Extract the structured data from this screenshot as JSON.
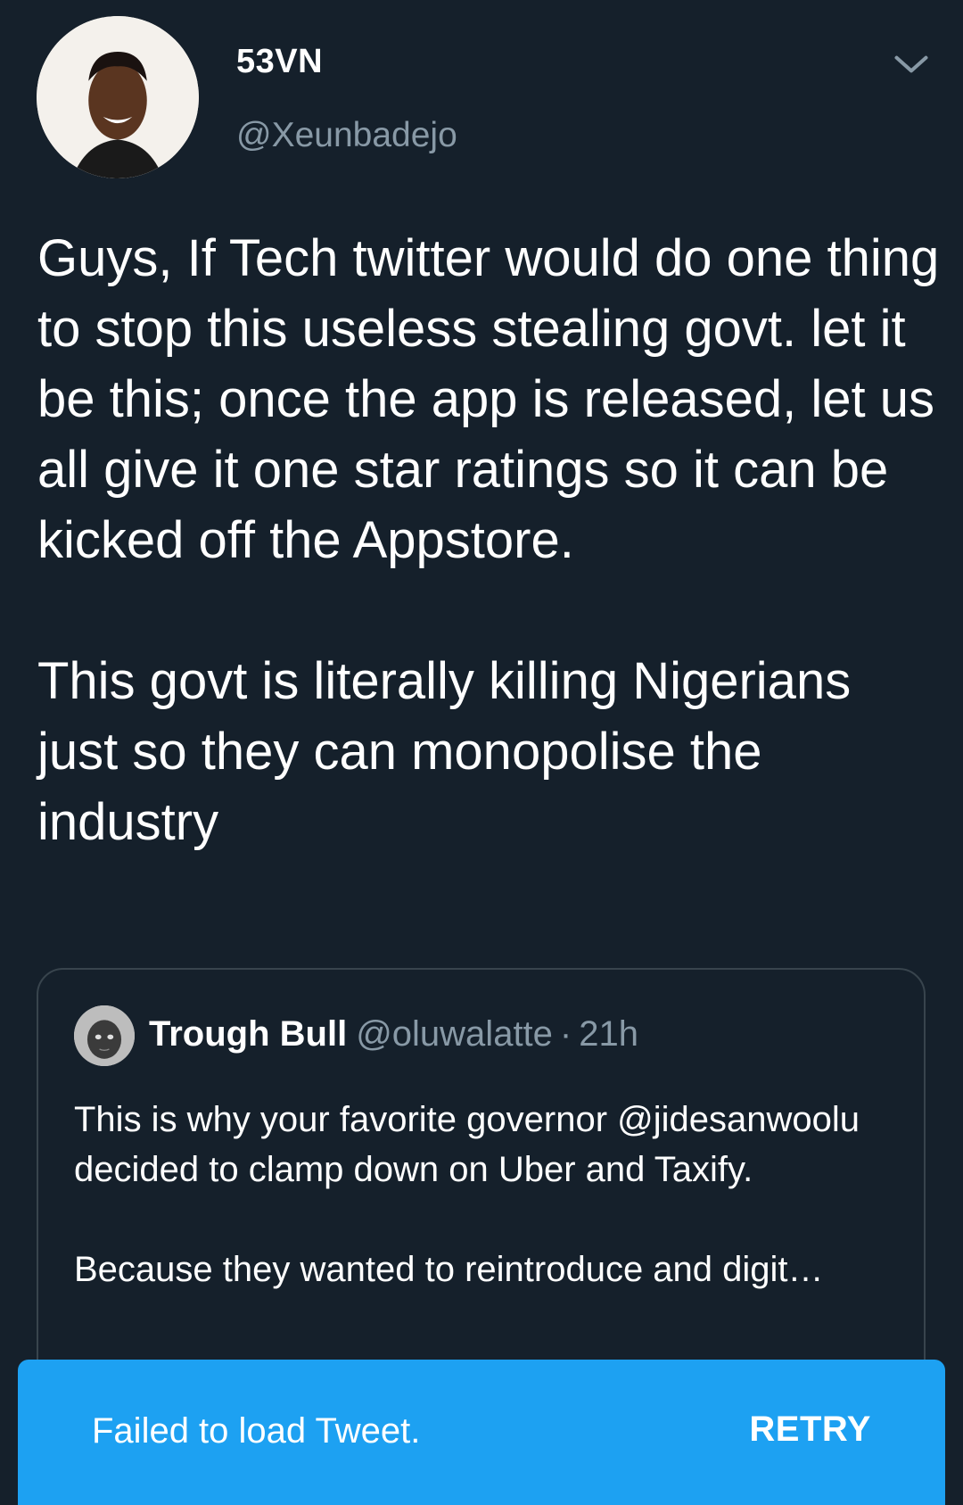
{
  "tweet": {
    "author": {
      "display_name": "53VN",
      "handle": "@Xeunbadejo"
    },
    "text": "Guys, If Tech twitter would do one thing to stop this useless stealing govt. let it be this; once the app is released, let us all give it one star ratings so it can be kicked off the Appstore.\n\nThis govt is literally killing Nigerians just so they can monopolise the industry",
    "menu_icon": "chevron-down-icon"
  },
  "quoted_tweet": {
    "display_name": "Trough Bull",
    "handle": "@oluwalatte",
    "separator": "·",
    "time": "21h",
    "text": "This is why your favorite governor @jidesanwoolu decided to clamp down on Uber and Taxify.\n\nBecause they wanted to reintroduce and digit…"
  },
  "snackbar": {
    "message": "Failed to load Tweet.",
    "action_label": "RETRY"
  },
  "colors": {
    "background": "#15202b",
    "secondary_text": "#8899a6",
    "border": "#38444d",
    "accent": "#1da1f2"
  }
}
